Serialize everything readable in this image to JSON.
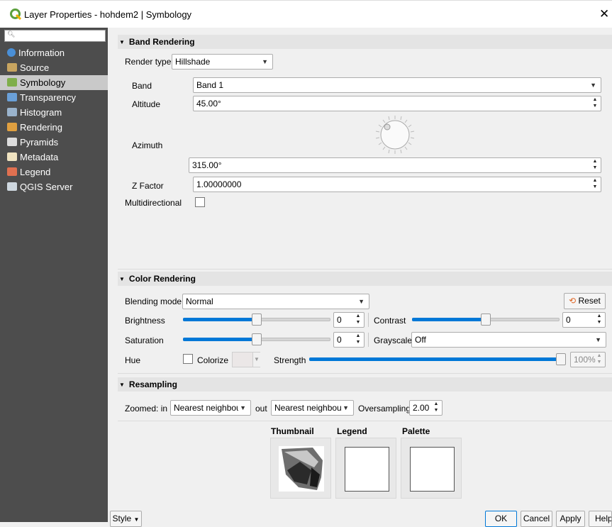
{
  "window": {
    "title": "Layer Properties - hohdem2 | Symbology",
    "close_glyph": "✕",
    "app_icon": "qgis-logo-icon"
  },
  "sidebar": {
    "search_icon": "search-icon",
    "items": [
      {
        "label": "Information",
        "icon": "info-icon",
        "color": "#4a8fd6"
      },
      {
        "label": "Source",
        "icon": "source-icon",
        "color": "#c8a560"
      },
      {
        "label": "Symbology",
        "icon": "paintbrush-icon",
        "color": "#7fae4a",
        "selected": true
      },
      {
        "label": "Transparency",
        "icon": "transparency-icon",
        "color": "#6aa0d8"
      },
      {
        "label": "Histogram",
        "icon": "histogram-icon",
        "color": "#9ab3cc"
      },
      {
        "label": "Rendering",
        "icon": "rendering-icon",
        "color": "#e0a040"
      },
      {
        "label": "Pyramids",
        "icon": "pyramids-icon",
        "color": "#dddddd"
      },
      {
        "label": "Metadata",
        "icon": "metadata-icon",
        "color": "#f0e3c0"
      },
      {
        "label": "Legend",
        "icon": "legend-icon",
        "color": "#e07050"
      },
      {
        "label": "QGIS Server",
        "icon": "server-icon",
        "color": "#cfd8e0"
      }
    ]
  },
  "band_rendering": {
    "title": "Band Rendering",
    "render_type_label": "Render type",
    "render_type_value": "Hillshade",
    "band_label": "Band",
    "band_value": "Band 1",
    "altitude_label": "Altitude",
    "altitude_value": "45.00°",
    "azimuth_label": "Azimuth",
    "azimuth_value": "315.00°",
    "zfactor_label": "Z Factor",
    "zfactor_value": "1.00000000",
    "multidirectional_label": "Multidirectional",
    "multidirectional_checked": false
  },
  "color_rendering": {
    "title": "Color Rendering",
    "blending_label": "Blending mode",
    "blending_value": "Normal",
    "reset_label": "Reset",
    "brightness_label": "Brightness",
    "brightness_value": "0",
    "brightness_level": 0.5,
    "contrast_label": "Contrast",
    "contrast_value": "0",
    "contrast_level": 0.5,
    "saturation_label": "Saturation",
    "saturation_value": "0",
    "saturation_level": 0.5,
    "grayscale_label": "Grayscale",
    "grayscale_value": "Off",
    "hue_label": "Hue",
    "colorize_label": "Colorize",
    "strength_label": "Strength",
    "strength_value": "100%",
    "strength_level": 1.0
  },
  "resampling": {
    "title": "Resampling",
    "zoomed_in_label": "Zoomed: in",
    "zoomed_in_value": "Nearest neighbour",
    "zoomed_out_label": "out",
    "zoomed_out_value": "Nearest neighbour",
    "oversampling_label": "Oversampling",
    "oversampling_value": "2.00"
  },
  "previews": {
    "thumbnail_label": "Thumbnail",
    "legend_label": "Legend",
    "palette_label": "Palette"
  },
  "footer": {
    "style_label": "Style",
    "ok_label": "OK",
    "cancel_label": "Cancel",
    "apply_label": "Apply",
    "help_label": "Help"
  },
  "colors": {
    "accent": "#0078d7",
    "sidebar_bg": "#4d4d4d"
  }
}
